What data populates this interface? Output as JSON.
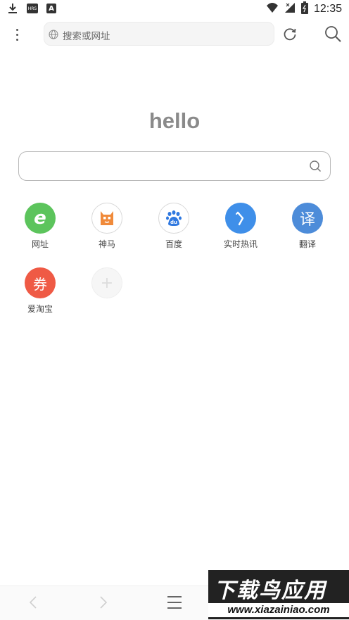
{
  "status_bar": {
    "time": "12:35",
    "left_icons": [
      "download-icon",
      "hrs-icon",
      "a-icon"
    ],
    "hrs_text": "HRS",
    "a_text": "A",
    "right_icons": [
      "wifi-icon",
      "signal-icon",
      "battery-icon"
    ]
  },
  "address_bar": {
    "placeholder": "搜索或网址"
  },
  "home": {
    "greeting": "hello"
  },
  "shortcuts": [
    {
      "label": "网址",
      "icon": "e-icon",
      "glyph": "e",
      "color": "#5cc45c"
    },
    {
      "label": "神马",
      "icon": "shenma-icon",
      "color": "#f08a3a"
    },
    {
      "label": "百度",
      "icon": "baidu-paw-icon",
      "glyph": "du",
      "color": "#2f78e0"
    },
    {
      "label": "实时热讯",
      "icon": "hot-news-icon",
      "color": "#3f8fe9"
    },
    {
      "label": "翻译",
      "icon": "translate-icon",
      "glyph": "译",
      "color": "#4d8cd9"
    },
    {
      "label": "爱淘宝",
      "icon": "coupon-icon",
      "glyph": "券",
      "color": "#ef5a45"
    },
    {
      "label": "",
      "icon": "add-icon",
      "glyph": "+"
    }
  ],
  "watermark": {
    "title": "下载鸟应用",
    "url": "www.xiazainiao.com"
  }
}
